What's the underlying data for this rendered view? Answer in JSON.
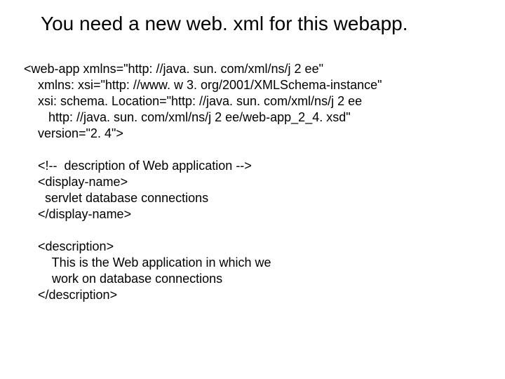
{
  "title": "You need a new web. xml for this webapp.",
  "lines": {
    "l1": "<web-app xmlns=\"http: //java. sun. com/xml/ns/j 2 ee\"",
    "l2": "    xmlns: xsi=\"http: //www. w 3. org/2001/XMLSchema-instance\"",
    "l3": "    xsi: schema. Location=\"http: //java. sun. com/xml/ns/j 2 ee",
    "l4": "       http: //java. sun. com/xml/ns/j 2 ee/web-app_2_4. xsd\"",
    "l5": "    version=\"2. 4\">",
    "blank1": "",
    "l6": "    <!--  description of Web application -->",
    "l7": "    <display-name>",
    "l8": "      servlet database connections",
    "l9": "    </display-name>",
    "blank2": "",
    "l10": "    <description>",
    "l11": "        This is the Web application in which we",
    "l12": "        work on database connections",
    "l13": "    </description>"
  }
}
